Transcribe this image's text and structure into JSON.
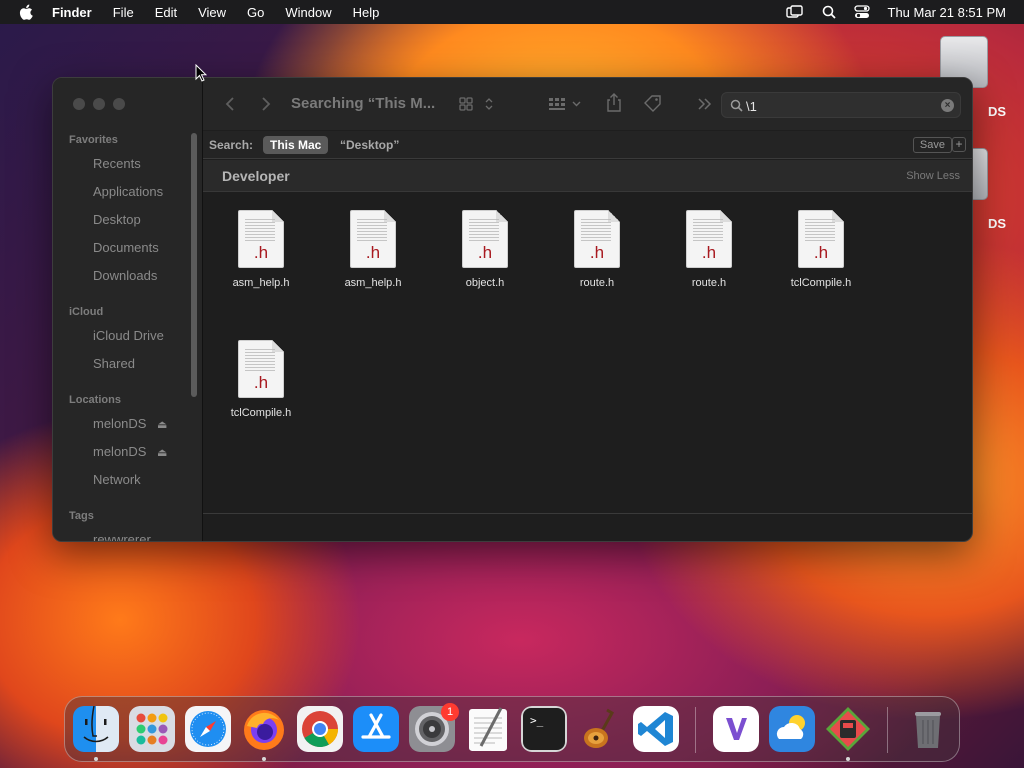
{
  "menubar": {
    "app_name": "Finder",
    "menus": [
      "File",
      "Edit",
      "View",
      "Go",
      "Window",
      "Help"
    ],
    "clock": "Thu Mar 21  8:51 PM"
  },
  "desktop": {
    "drive_labels": [
      "DS",
      "DS"
    ]
  },
  "finder": {
    "title": "Searching “This M...",
    "search": {
      "value": "\\1"
    },
    "scope": {
      "label": "Search:",
      "this_mac": "This Mac",
      "desktop": "“Desktop”",
      "save": "Save",
      "plus": "+"
    },
    "sidebar": {
      "favorites_header": "Favorites",
      "favorites": [
        "Recents",
        "Applications",
        "Desktop",
        "Documents",
        "Downloads"
      ],
      "icloud_header": "iCloud",
      "icloud": [
        "iCloud Drive",
        "Shared"
      ],
      "locations_header": "Locations",
      "locations": [
        "melonDS",
        "melonDS",
        "Network"
      ],
      "tags_header": "Tags",
      "tags": [
        "rewwrerer"
      ]
    },
    "group": {
      "name": "Developer",
      "toggle": "Show Less"
    },
    "files": [
      {
        "name": "asm_help.h",
        "ext": ".h"
      },
      {
        "name": "asm_help.h",
        "ext": ".h"
      },
      {
        "name": "object.h",
        "ext": ".h"
      },
      {
        "name": "route.h",
        "ext": ".h"
      },
      {
        "name": "route.h",
        "ext": ".h"
      },
      {
        "name": "tclCompile.h",
        "ext": ".h"
      },
      {
        "name": "tclCompile.h",
        "ext": ".h"
      }
    ]
  },
  "dock": {
    "apps": [
      "finder-icon",
      "launchpad-icon",
      "safari-icon",
      "firefox-icon",
      "chrome-icon",
      "app-store-icon",
      "system-settings-icon",
      "textedit-icon",
      "terminal-icon",
      "garageband-icon",
      "vscode-icon",
      "visual-studio-icon",
      "weather-icon",
      "melonds-icon",
      "trash-icon"
    ],
    "settings_badge": "1"
  }
}
